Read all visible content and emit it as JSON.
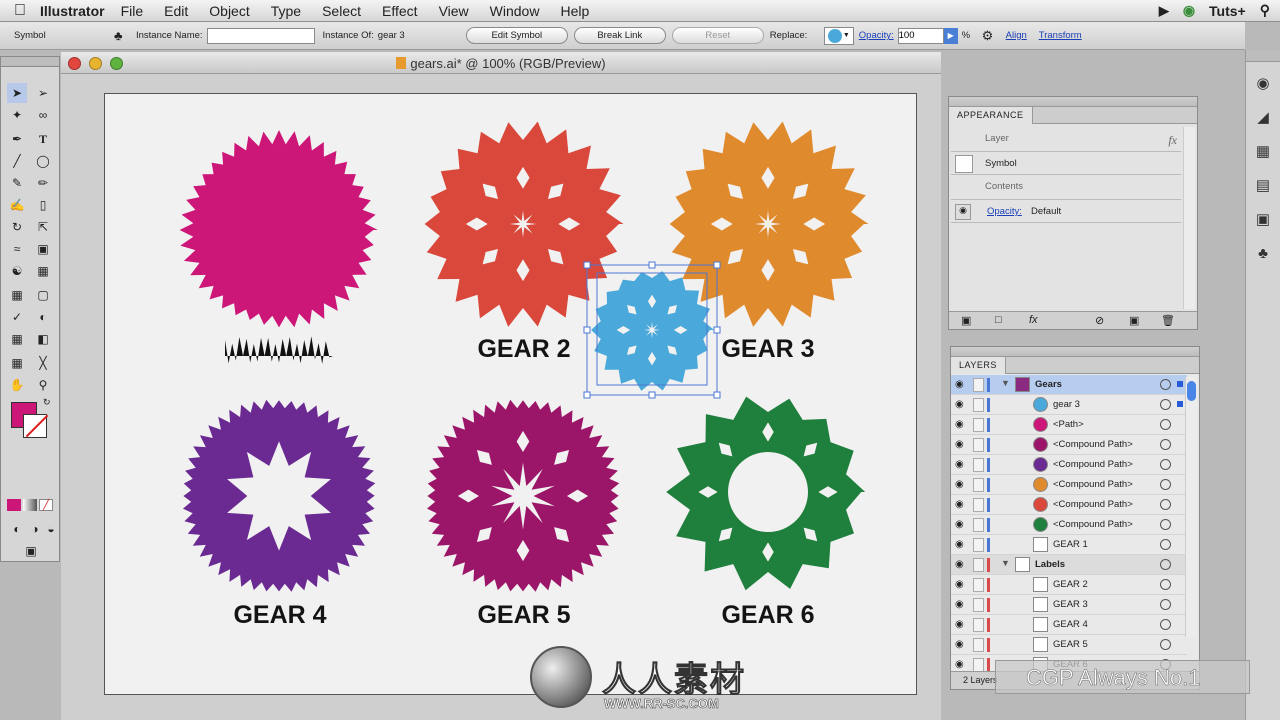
{
  "menubar": {
    "app_name": "Illustrator",
    "items": [
      "File",
      "Edit",
      "Object",
      "Type",
      "Select",
      "Effect",
      "View",
      "Window",
      "Help"
    ],
    "right_label": "Tuts+"
  },
  "controlbar": {
    "selection_type": "Symbol",
    "instance_name_label": "Instance Name:",
    "instance_name_value": "",
    "instance_of_label": "Instance Of:",
    "instance_of_value": "gear 3",
    "edit_symbol": "Edit Symbol",
    "break_link": "Break Link",
    "reset": "Reset",
    "replace_label": "Replace:",
    "opacity_label": "Opacity:",
    "opacity_value": "100",
    "percent": "%",
    "align": "Align",
    "transform": "Transform"
  },
  "document": {
    "title": "gears.ai* @ 100% (RGB/Preview)",
    "gears": [
      {
        "label": "",
        "color": "#cc1779"
      },
      {
        "label": "GEAR 2",
        "color": "#d9483a"
      },
      {
        "label": "GEAR 3",
        "color": "#e08a2e"
      },
      {
        "label": "GEAR 4",
        "color": "#6a2a92"
      },
      {
        "label": "GEAR 5",
        "color": "#9b1668"
      },
      {
        "label": "GEAR 6",
        "color": "#1f7f3d"
      },
      {
        "label": "",
        "color": "#4aa9da"
      }
    ]
  },
  "appearance": {
    "tab": "APPEARANCE",
    "layer_label": "Layer",
    "symbol_label": "Symbol",
    "contents_label": "Contents",
    "opacity_label": "Opacity:",
    "opacity_value": "Default",
    "fx": "fx"
  },
  "layers": {
    "tab": "LAYERS",
    "rows": [
      {
        "name": "Gears",
        "kind": "layer",
        "color": "#4a77d4",
        "thumb": "#8a2a80",
        "selected": true
      },
      {
        "name": "gear 3",
        "kind": "item",
        "color": "#4a77d4",
        "thumb": "#4aa9da"
      },
      {
        "name": "<Path>",
        "kind": "item",
        "color": "#4a77d4",
        "thumb": "#cc1779"
      },
      {
        "name": "<Compound Path>",
        "kind": "item",
        "color": "#4a77d4",
        "thumb": "#9b1668"
      },
      {
        "name": "<Compound Path>",
        "kind": "item",
        "color": "#4a77d4",
        "thumb": "#6a2a92"
      },
      {
        "name": "<Compound Path>",
        "kind": "item",
        "color": "#4a77d4",
        "thumb": "#e08a2e"
      },
      {
        "name": "<Compound Path>",
        "kind": "item",
        "color": "#4a77d4",
        "thumb": "#d9483a"
      },
      {
        "name": "<Compound Path>",
        "kind": "item",
        "color": "#4a77d4",
        "thumb": "#1f7f3d"
      },
      {
        "name": "GEAR 1",
        "kind": "item",
        "color": "#4a77d4",
        "thumb": "#ffffff"
      },
      {
        "name": "Labels",
        "kind": "layer",
        "color": "#d94a4a",
        "thumb": "#ffffff"
      },
      {
        "name": "GEAR 2",
        "kind": "item",
        "color": "#d94a4a",
        "thumb": "#ffffff"
      },
      {
        "name": "GEAR 3",
        "kind": "item",
        "color": "#d94a4a",
        "thumb": "#ffffff"
      },
      {
        "name": "GEAR 4",
        "kind": "item",
        "color": "#d94a4a",
        "thumb": "#ffffff"
      },
      {
        "name": "GEAR 5",
        "kind": "item",
        "color": "#d94a4a",
        "thumb": "#ffffff"
      },
      {
        "name": "GEAR 6",
        "kind": "item",
        "color": "#d94a4a",
        "thumb": "#ffffff"
      }
    ],
    "footer": "2 Layers"
  },
  "watermark": {
    "brand": "人人素材",
    "url": "WWW.RR-SC.COM",
    "cgp": "CGP Always No.1"
  }
}
